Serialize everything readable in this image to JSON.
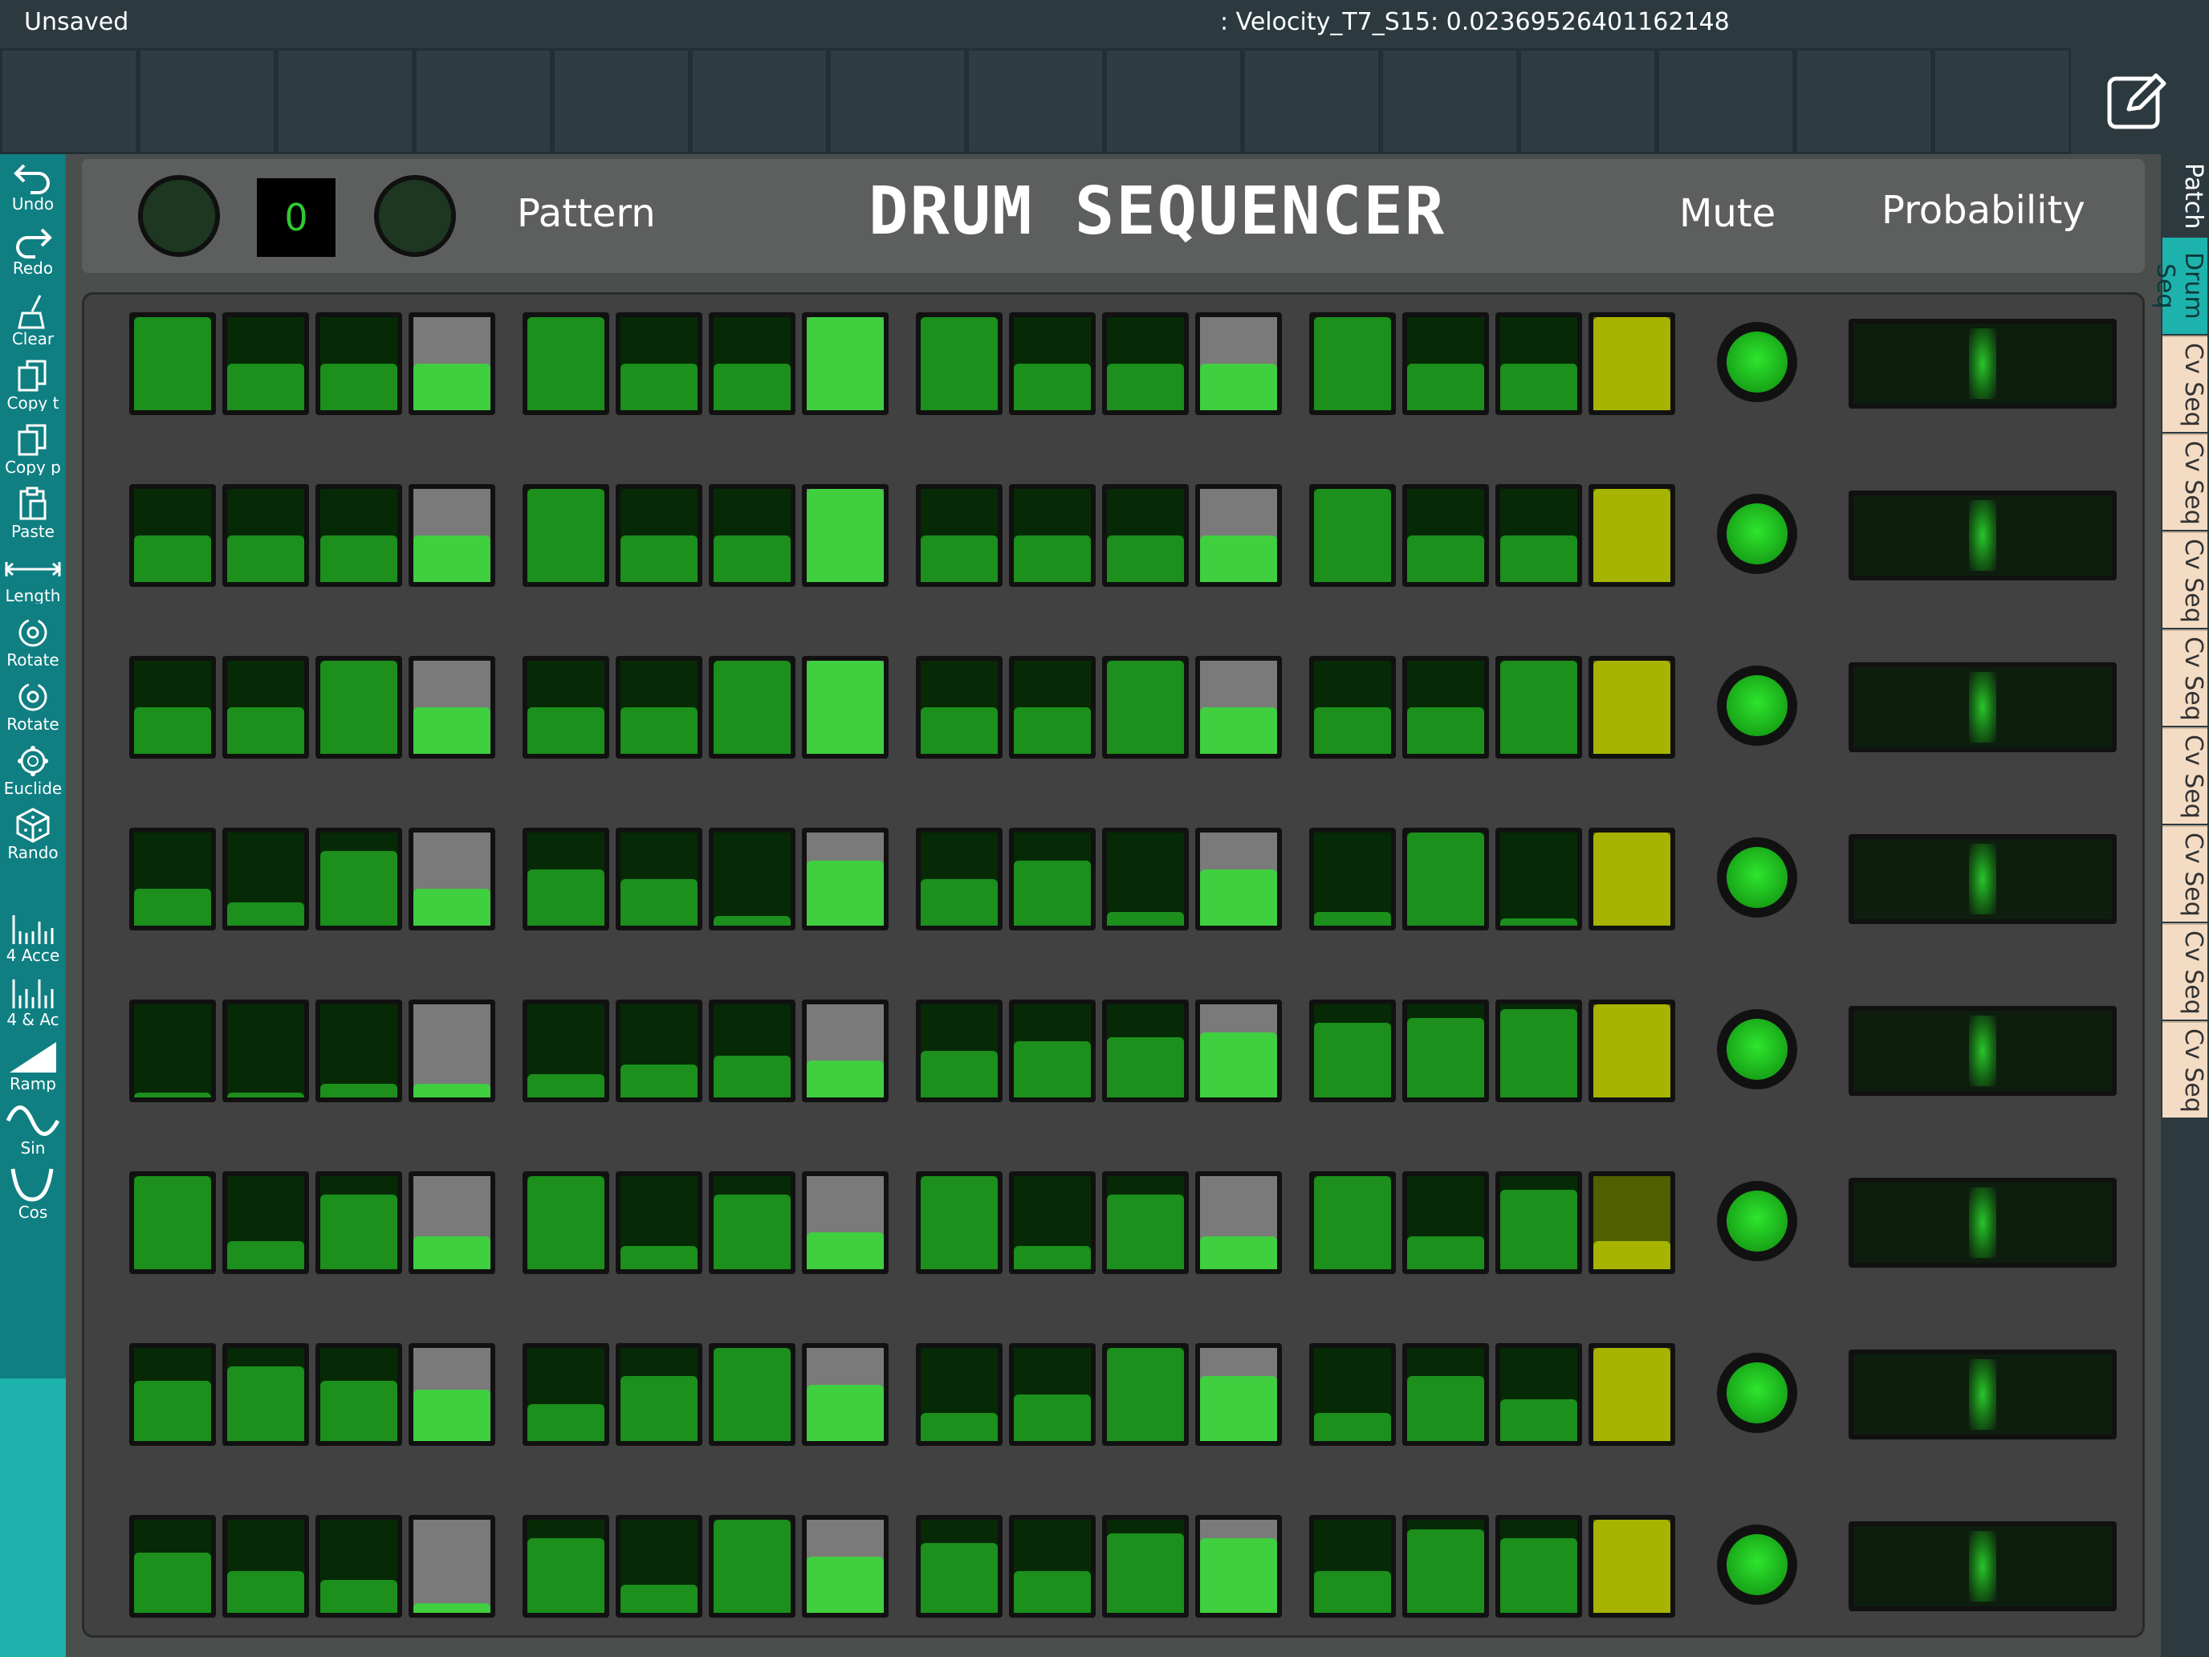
{
  "topbar": {
    "title": "Unsaved",
    "status": ": Velocity_T7_S15: 0.02369526401162148"
  },
  "toolbar": [
    {
      "label": "Undo",
      "icon": "undo-icon"
    },
    {
      "label": "Redo",
      "icon": "redo-icon"
    },
    {
      "label": "Clear",
      "icon": "broom-icon"
    },
    {
      "label": "Copy t",
      "icon": "copy-icon"
    },
    {
      "label": "Copy p",
      "icon": "copy-icon"
    },
    {
      "label": "Paste",
      "icon": "paste-icon"
    },
    {
      "label": "Length",
      "icon": "length-icon"
    },
    {
      "label": "Rotate",
      "icon": "rotate-icon"
    },
    {
      "label": "Rotate",
      "icon": "rotate-icon"
    },
    {
      "label": "Euclide",
      "icon": "euclid-icon"
    },
    {
      "label": "Rando",
      "icon": "dice-icon"
    },
    {
      "label": "4 Acce",
      "icon": "bars-icon"
    },
    {
      "label": "4 & Ac",
      "icon": "bars-icon"
    },
    {
      "label": "Ramp",
      "icon": "ramp-icon"
    },
    {
      "label": "Sin",
      "icon": "sine-icon"
    },
    {
      "label": "Cos",
      "icon": "cosine-icon"
    }
  ],
  "header": {
    "pattern_value": "0",
    "pattern_label": "Pattern",
    "title": "DRUM SEQUENCER",
    "mute_label": "Mute",
    "probability_label": "Probability"
  },
  "sequencer": {
    "tracks": [
      [
        1,
        0.5,
        0.5,
        0.5,
        1,
        0.5,
        0.5,
        1,
        1,
        0.5,
        0.5,
        0.5,
        1,
        0.5,
        0.5,
        1
      ],
      [
        0.5,
        0.5,
        0.5,
        0.5,
        1,
        0.5,
        0.5,
        1,
        0.5,
        0.5,
        0.5,
        0.5,
        1,
        0.5,
        0.5,
        1
      ],
      [
        0.5,
        0.5,
        1,
        0.5,
        0.5,
        0.5,
        1,
        1,
        0.5,
        0.5,
        1,
        0.5,
        0.5,
        0.5,
        1,
        1
      ],
      [
        0.4,
        0.25,
        0.8,
        0.4,
        0.6,
        0.5,
        0.1,
        0.7,
        0.5,
        0.7,
        0.15,
        0.6,
        0.15,
        1,
        0.08,
        1
      ],
      [
        0.05,
        0.05,
        0.15,
        0.15,
        0.25,
        0.35,
        0.45,
        0.4,
        0.5,
        0.6,
        0.65,
        0.7,
        0.8,
        0.85,
        0.95,
        1
      ],
      [
        1,
        0.3,
        0.8,
        0.35,
        1,
        0.25,
        0.8,
        0.4,
        1,
        0.25,
        0.8,
        0.35,
        1,
        0.35,
        0.85,
        0.3
      ],
      [
        0.65,
        0.8,
        0.65,
        0.55,
        0.4,
        0.7,
        1,
        0.6,
        0.3,
        0.5,
        1,
        0.7,
        0.3,
        0.7,
        0.45,
        1
      ],
      [
        0.65,
        0.45,
        0.35,
        0.1,
        0.8,
        0.3,
        1,
        0.6,
        0.75,
        0.45,
        0.85,
        0.8,
        0.45,
        0.9,
        0.8,
        1
      ]
    ],
    "mute_active": [
      true,
      true,
      true,
      true,
      true,
      true,
      true,
      true
    ],
    "probability": [
      0.5,
      0.5,
      0.5,
      0.5,
      0.5,
      0.5,
      0.5,
      0.5
    ],
    "colors": {
      "on": "#3fcf3f",
      "off": "#052a05",
      "accent": "#7a7a7a",
      "last": "#a6b400"
    }
  },
  "tabs": [
    {
      "label": "Patch",
      "type": "patch"
    },
    {
      "label": "Drum Seq",
      "type": "drum"
    },
    {
      "label": "Cv Seq",
      "type": "cv"
    },
    {
      "label": "Cv Seq",
      "type": "cv"
    },
    {
      "label": "Cv Seq",
      "type": "cv"
    },
    {
      "label": "Cv Seq",
      "type": "cv"
    },
    {
      "label": "Cv Seq",
      "type": "cv"
    },
    {
      "label": "Cv Seq",
      "type": "cv"
    },
    {
      "label": "Cv Seq",
      "type": "cv"
    },
    {
      "label": "Cv Seq",
      "type": "cv"
    }
  ]
}
